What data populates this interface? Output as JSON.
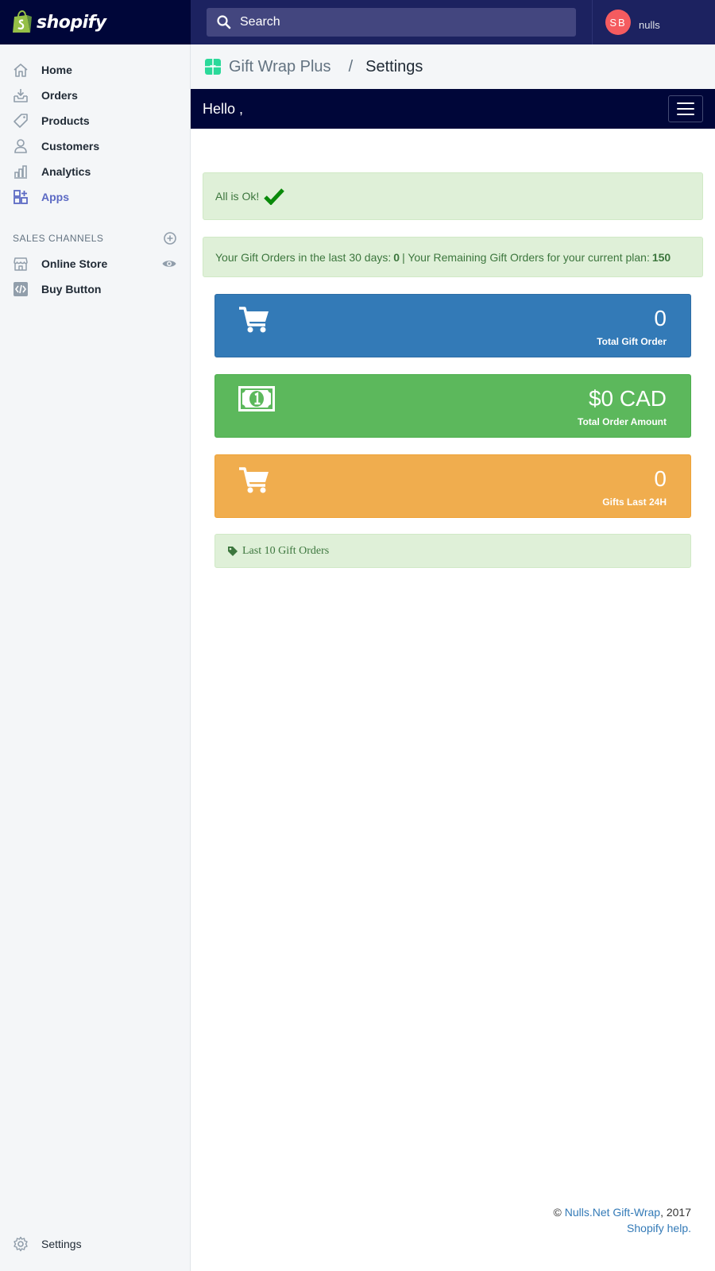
{
  "topbar": {
    "brand": "shopify",
    "search_placeholder": "Search",
    "user_initials": "SB",
    "user_name": "nulls"
  },
  "sidebar": {
    "items": [
      {
        "label": "Home",
        "icon": "home-icon"
      },
      {
        "label": "Orders",
        "icon": "orders-icon"
      },
      {
        "label": "Products",
        "icon": "tag-icon"
      },
      {
        "label": "Customers",
        "icon": "person-icon"
      },
      {
        "label": "Analytics",
        "icon": "bar-chart-icon"
      },
      {
        "label": "Apps",
        "icon": "apps-icon",
        "active": true
      }
    ],
    "sales_channels_heading": "SALES CHANNELS",
    "channels": [
      {
        "label": "Online Store",
        "icon": "store-icon"
      },
      {
        "label": "Buy Button",
        "icon": "code-icon"
      }
    ],
    "settings_label": "Settings"
  },
  "main": {
    "breadcrumb_app": "Gift Wrap Plus",
    "breadcrumb_sep": "/",
    "breadcrumb_page": "Settings",
    "hello": "Hello ,",
    "status_message": "All is Ok!",
    "stats": {
      "prefix": "Your Gift Orders in the last 30 days:",
      "orders_30d": "0",
      "middle": "| Your Remaining Gift Orders for your current plan:",
      "remaining": "150"
    },
    "cards": [
      {
        "value": "0",
        "label": "Total Gift Order",
        "color": "#337ab7",
        "icon": "cart-icon"
      },
      {
        "value": "$0 CAD",
        "label": "Total Order Amount",
        "color": "#5cb85c",
        "icon": "money-icon"
      },
      {
        "value": "0",
        "label": "Gifts Last 24H",
        "color": "#f0ad4e",
        "icon": "cart-icon"
      }
    ],
    "last_orders_label": "Last 10 Gift Orders"
  },
  "footer": {
    "copyright": "©",
    "link_text": "Nulls.Net Gift-Wrap",
    "year": ", 2017",
    "help_link": "Shopify help."
  },
  "colors": {
    "topbar": "#1c2260",
    "brand_bg": "#000639",
    "accent": "#5c6ac4",
    "success_bg": "#dff0d8",
    "success_text": "#3c763d"
  }
}
